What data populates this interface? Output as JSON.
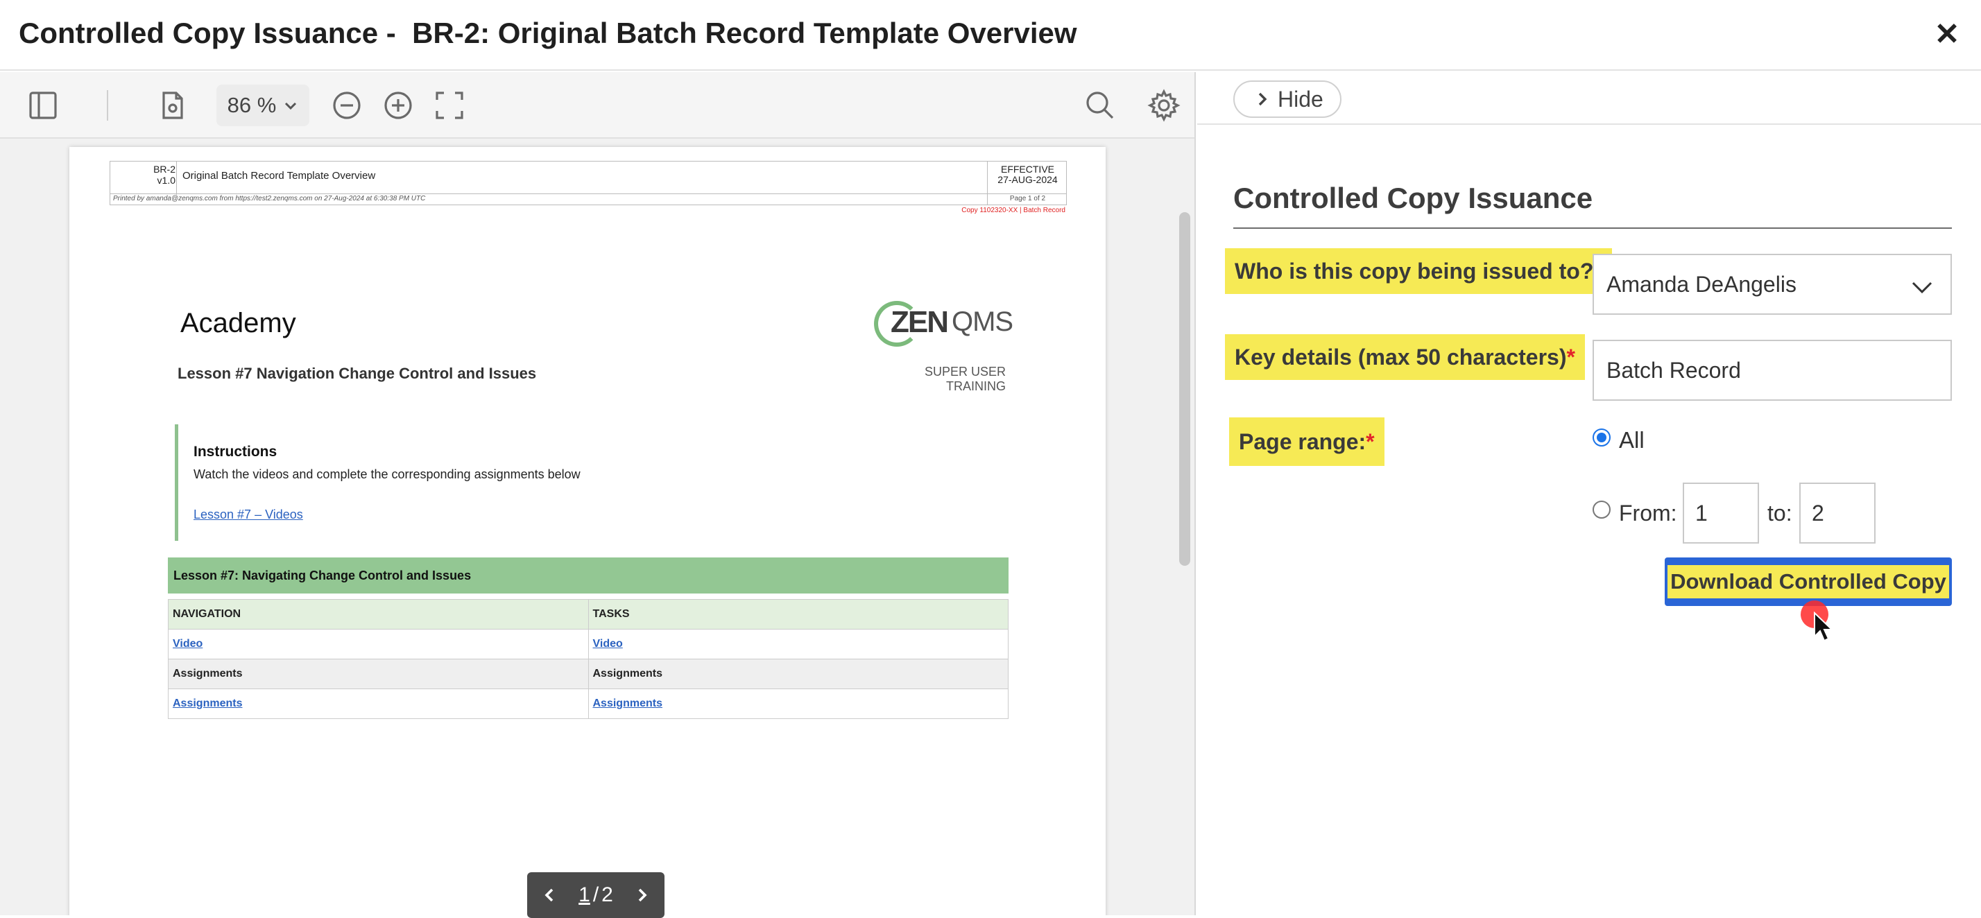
{
  "window": {
    "title": "Controlled Copy Issuance -  BR-2: Original Batch Record Template Overview",
    "close_icon": "close-icon"
  },
  "viewer": {
    "toolbar": {
      "icons": [
        "sidebar-toggle-icon",
        "document-settings-icon",
        "zoom-out-icon",
        "zoom-in-icon",
        "fullscreen-icon",
        "search-icon",
        "gear-icon"
      ],
      "zoom_value": "86 %"
    },
    "document": {
      "header": {
        "doc_id": "BR-2",
        "version": "v1.0",
        "doc_name": "Original Batch Record Template Overview",
        "effective_label": "EFFECTIVE",
        "effective_date": "27-AUG-2024",
        "printed_by": "Printed by amanda@zenqms.com from https://test2.zenqms.com on 27-Aug-2024 at 6:30:38 PM UTC",
        "page_info": "Page 1 of 2",
        "copy_info": "Copy 1102320-XX | Batch Record"
      },
      "org_name": "Academy",
      "lesson_subtitle": "Lesson #7 Navigation Change Control and Issues",
      "logo": {
        "zen": "ZEN",
        "qms": "QMS"
      },
      "tagline": "SUPER USER TRAINING",
      "instructions": {
        "heading": "Instructions",
        "text": "Watch the videos and complete the corresponding assignments below",
        "link": "Lesson #7 – Videos"
      },
      "lesson_bar": "Lesson #7: Navigating Change Control and Issues",
      "table": {
        "headers": [
          "NAVIGATION",
          "TASKS"
        ],
        "row1": [
          "Video",
          "Video"
        ],
        "row2": [
          "Assignments",
          "Assignments"
        ],
        "row3": [
          "Assignments",
          "Assignments"
        ]
      }
    },
    "pager": {
      "current": "1",
      "separator": "/",
      "total": "2"
    }
  },
  "panel": {
    "hide_label": "Hide",
    "heading": "Controlled Copy Issuance",
    "who_label": "Who is this copy being issued to?",
    "who_value": "Amanda DeAngelis",
    "key_label": "Key details (max 50 characters)",
    "key_value": "Batch Record",
    "range_label": "Page range:",
    "required_mark": "*",
    "option_all": "All",
    "option_from": "From:",
    "from_value": "1",
    "to_label": "to:",
    "to_value": "2",
    "download_label": "Download Controlled Copy",
    "colors": {
      "accent": "#2a65d6",
      "highlight": "#f6ea55",
      "required": "#e3242b"
    }
  }
}
